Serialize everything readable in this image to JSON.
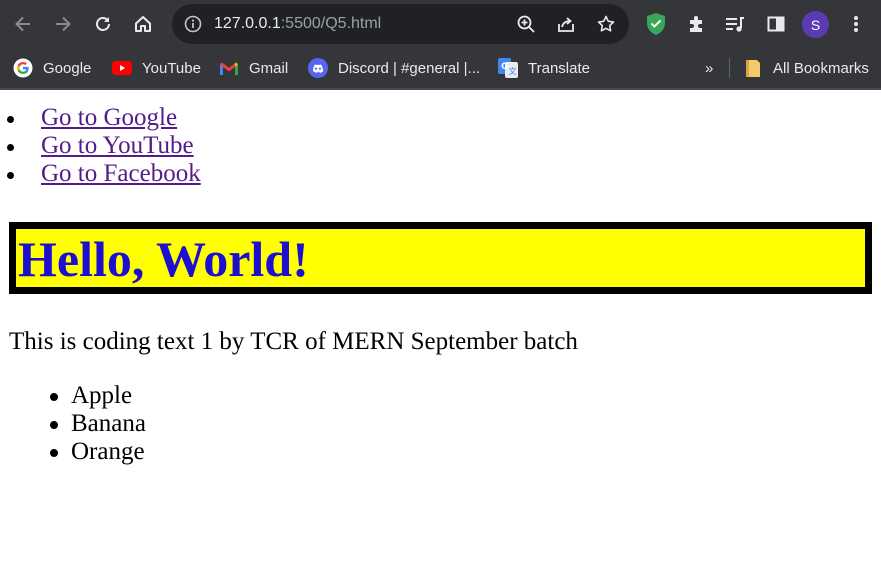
{
  "browser": {
    "address_host": "127.0.0.1",
    "address_path": ":5500/Q5.html",
    "profile_initial": "S",
    "icons": [
      "back-icon",
      "forward-icon",
      "reload-icon",
      "home-icon",
      "info-icon",
      "zoom-icon",
      "share-icon",
      "star-icon",
      "shield-extension-icon",
      "puzzle-icon",
      "media-icon",
      "side-panel-icon",
      "more-icon"
    ]
  },
  "bookmarks": {
    "items": [
      {
        "label": "Google",
        "icon": "google-icon"
      },
      {
        "label": "YouTube",
        "icon": "youtube-icon"
      },
      {
        "label": "Gmail",
        "icon": "gmail-icon"
      },
      {
        "label": "Discord | #general |...",
        "icon": "discord-icon"
      },
      {
        "label": "Translate",
        "icon": "translate-icon"
      }
    ],
    "overflow": "»",
    "all_bookmarks": "All Bookmarks"
  },
  "page": {
    "links": [
      "Go to Google",
      "Go to YouTube",
      "Go to Facebook"
    ],
    "heading": "Hello, World!",
    "paragraph": "This is coding text 1 by TCR of MERN September batch",
    "fruits": [
      "Apple",
      "Banana",
      "Orange"
    ]
  },
  "colors": {
    "toolbar_bg": "#35363a",
    "link_visited": "#551a8b",
    "heading_text": "#1c0fd0",
    "heading_bg": "#ffff00",
    "heading_border": "#000000"
  }
}
